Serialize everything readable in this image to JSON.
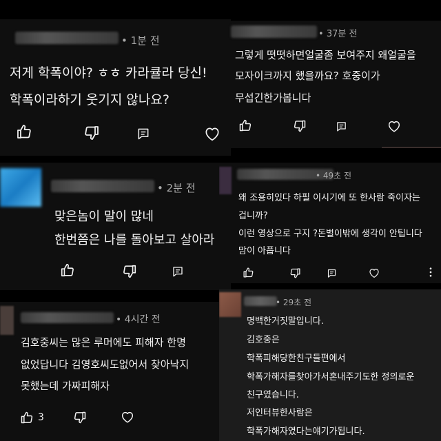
{
  "comments": [
    {
      "time": "1분 전",
      "lines": [
        "저게 학폭이야? ㅎㅎ 카라큘라 당신!",
        "학폭이라하기 웃기지 않나요?"
      ]
    },
    {
      "time": "37분 전",
      "lines": [
        "그렇게 떳떳하면얼굴좀 보여주지 왜얼굴을",
        "모자이크까지 했을까요? 호중이가",
        "무섭긴한가봅니다"
      ]
    },
    {
      "time": "2분 전",
      "lines": [
        "맞은놈이 말이 많네",
        "한번쯤은 나를 돌아보고 살아라"
      ]
    },
    {
      "time": "49초 전",
      "lines": [
        "왜 조용히있다 하필 이시기에 또 한사람 죽이자는",
        "겁니까?",
        "이런 영상으로 구지 ?돈벌이밖에 생각이 안팁니다",
        "맘이 아픕니다"
      ]
    },
    {
      "time": "4시간 전",
      "lines": [
        "김호중씨는 많은 루머에도 피해자 한명",
        "없었답니다 김영호씨도없어서 찾아낙지",
        "못했는데 가짜피해자"
      ],
      "like_count": "3"
    },
    {
      "time": "29초 전",
      "lines": [
        "명백한거짓말입니다.",
        "김호중은",
        "학폭피해당한친구들편에서",
        "학폭가해자를찾아가서혼내주기도한 정의로운",
        "친구였습니다.",
        "저인터뷰한사람은",
        "학폭가해자였다는얘기가됩니다."
      ]
    }
  ],
  "icons": [
    "thumb-up-icon",
    "thumb-down-icon",
    "reply-icon",
    "heart-icon",
    "more-vert-icon"
  ]
}
